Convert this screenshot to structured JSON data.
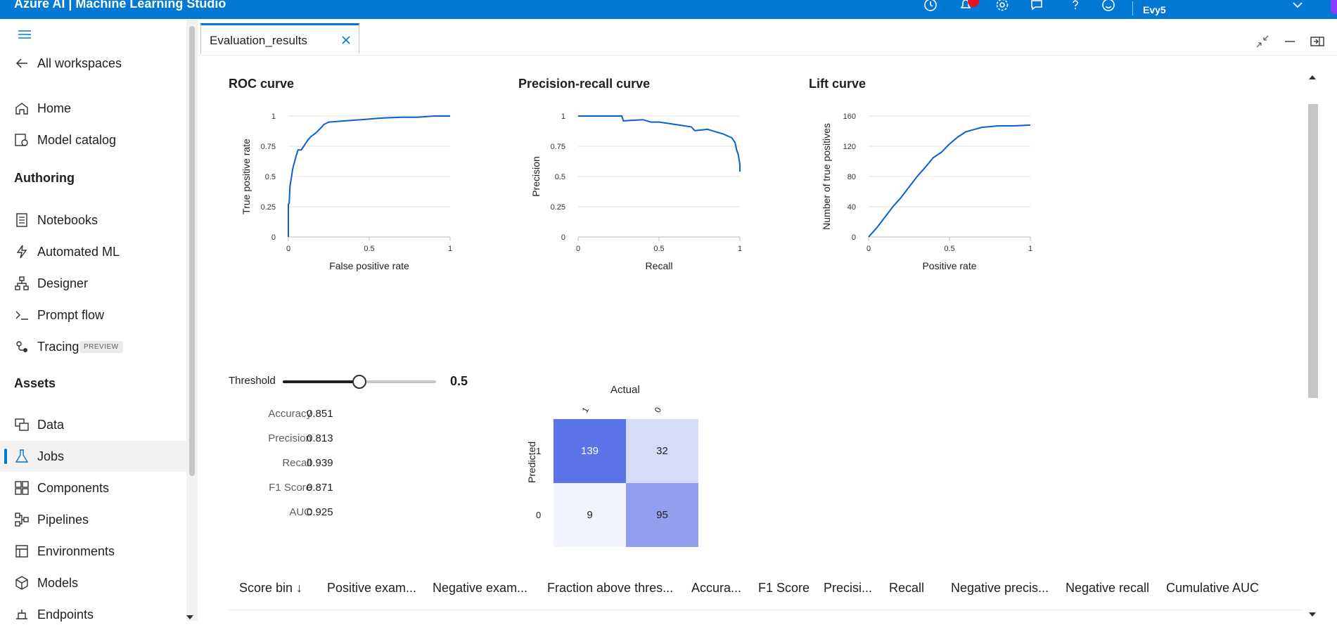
{
  "app": {
    "title": "Azure AI | Machine Learning Studio",
    "user": "Evy5"
  },
  "topbar_icons": [
    "history-icon",
    "notification-icon",
    "settings-icon",
    "feedback-icon",
    "help-icon",
    "smiley-icon"
  ],
  "sidebar": {
    "back_label": "All workspaces",
    "home": "Home",
    "model_catalog": "Model catalog",
    "authoring_header": "Authoring",
    "notebooks": "Notebooks",
    "automated_ml": "Automated ML",
    "designer": "Designer",
    "prompt_flow": "Prompt flow",
    "tracing": "Tracing",
    "tracing_badge": "PREVIEW",
    "assets_header": "Assets",
    "data": "Data",
    "jobs": "Jobs",
    "components": "Components",
    "pipelines": "Pipelines",
    "environments": "Environments",
    "models": "Models",
    "endpoints": "Endpoints"
  },
  "tab": {
    "label": "Evaluation_results"
  },
  "charts": {
    "roc_title": "ROC curve",
    "pr_title": "Precision-recall curve",
    "lift_title": "Lift curve"
  },
  "chart_data": [
    {
      "type": "line",
      "title": "ROC curve",
      "xlabel": "False positive rate",
      "ylabel": "True positive rate",
      "xlim": [
        0,
        1
      ],
      "ylim": [
        0,
        1
      ],
      "xticks": [
        "0",
        "0.5",
        "1"
      ],
      "yticks": [
        "0",
        "0.25",
        "0.5",
        "0.75",
        "1"
      ],
      "grid": true,
      "color": "#0a5fd1",
      "x": [
        0,
        0,
        0.005,
        0.01,
        0.02,
        0.025,
        0.03,
        0.04,
        0.05,
        0.06,
        0.08,
        0.12,
        0.14,
        0.17,
        0.2,
        0.22,
        0.25,
        0.35,
        0.45,
        0.55,
        0.6,
        0.7,
        0.8,
        0.9,
        1
      ],
      "y": [
        0,
        0.27,
        0.28,
        0.42,
        0.5,
        0.55,
        0.58,
        0.63,
        0.68,
        0.72,
        0.72,
        0.8,
        0.83,
        0.86,
        0.9,
        0.93,
        0.95,
        0.96,
        0.97,
        0.98,
        0.985,
        0.99,
        0.99,
        1.0,
        1.0
      ]
    },
    {
      "type": "line",
      "title": "Precision-recall curve",
      "xlabel": "Recall",
      "ylabel": "Precision",
      "xlim": [
        0,
        1
      ],
      "ylim": [
        0,
        1
      ],
      "xticks": [
        "0",
        "0.5",
        "1"
      ],
      "yticks": [
        "0",
        "0.25",
        "0.5",
        "0.75",
        "1"
      ],
      "grid": true,
      "color": "#0a5fd1",
      "x": [
        0,
        0.27,
        0.28,
        0.4,
        0.45,
        0.5,
        0.55,
        0.6,
        0.65,
        0.7,
        0.72,
        0.73,
        0.8,
        0.85,
        0.9,
        0.95,
        0.97,
        0.98,
        0.99,
        1.0,
        1.0
      ],
      "y": [
        1.0,
        1.0,
        0.96,
        0.97,
        0.95,
        0.95,
        0.94,
        0.93,
        0.92,
        0.91,
        0.88,
        0.88,
        0.89,
        0.87,
        0.85,
        0.82,
        0.78,
        0.72,
        0.68,
        0.6,
        0.54
      ]
    },
    {
      "type": "line",
      "title": "Lift curve",
      "xlabel": "Positive rate",
      "ylabel": "Number of true positives",
      "xlim": [
        0,
        1
      ],
      "ylim": [
        0,
        160
      ],
      "xticks": [
        "0",
        "0.5",
        "1"
      ],
      "yticks": [
        "0",
        "40",
        "80",
        "120",
        "160"
      ],
      "grid": true,
      "color": "#0a5fd1",
      "x": [
        0,
        0.05,
        0.1,
        0.15,
        0.2,
        0.25,
        0.3,
        0.35,
        0.4,
        0.45,
        0.5,
        0.55,
        0.6,
        0.65,
        0.7,
        0.75,
        0.8,
        0.9,
        1.0
      ],
      "y": [
        0,
        12,
        26,
        40,
        52,
        66,
        80,
        92,
        105,
        112,
        123,
        132,
        139,
        142,
        145,
        146,
        147,
        147,
        148
      ]
    }
  ],
  "threshold": {
    "label": "Threshold",
    "value": 0.5,
    "value_text": "0.5"
  },
  "metrics": [
    {
      "name": "Accuracy",
      "value": "0.851"
    },
    {
      "name": "Precision",
      "value": "0.813"
    },
    {
      "name": "Recall",
      "value": "0.939"
    },
    {
      "name": "F1 Score",
      "value": "0.871"
    },
    {
      "name": "AUC",
      "value": "0.925"
    }
  ],
  "confusion_matrix": {
    "actual_label": "Actual",
    "predicted_label": "Predicted",
    "col_labels": [
      "1",
      "0"
    ],
    "row_labels": [
      "1",
      "0"
    ],
    "cells": [
      [
        "139",
        "32"
      ],
      [
        "9",
        "95"
      ]
    ],
    "colors": [
      [
        "#5a73e6",
        "#d6dcf8"
      ],
      [
        "#f1f3fd",
        "#919fee"
      ]
    ]
  },
  "table": {
    "headers": [
      "Score bin ↓",
      "Positive exam...",
      "Negative exam...",
      "Fraction above thres...",
      "Accura...",
      "F1 Score",
      "Precisi...",
      "Recall",
      "Negative precis...",
      "Negative recall",
      "Cumulative AUC"
    ]
  }
}
